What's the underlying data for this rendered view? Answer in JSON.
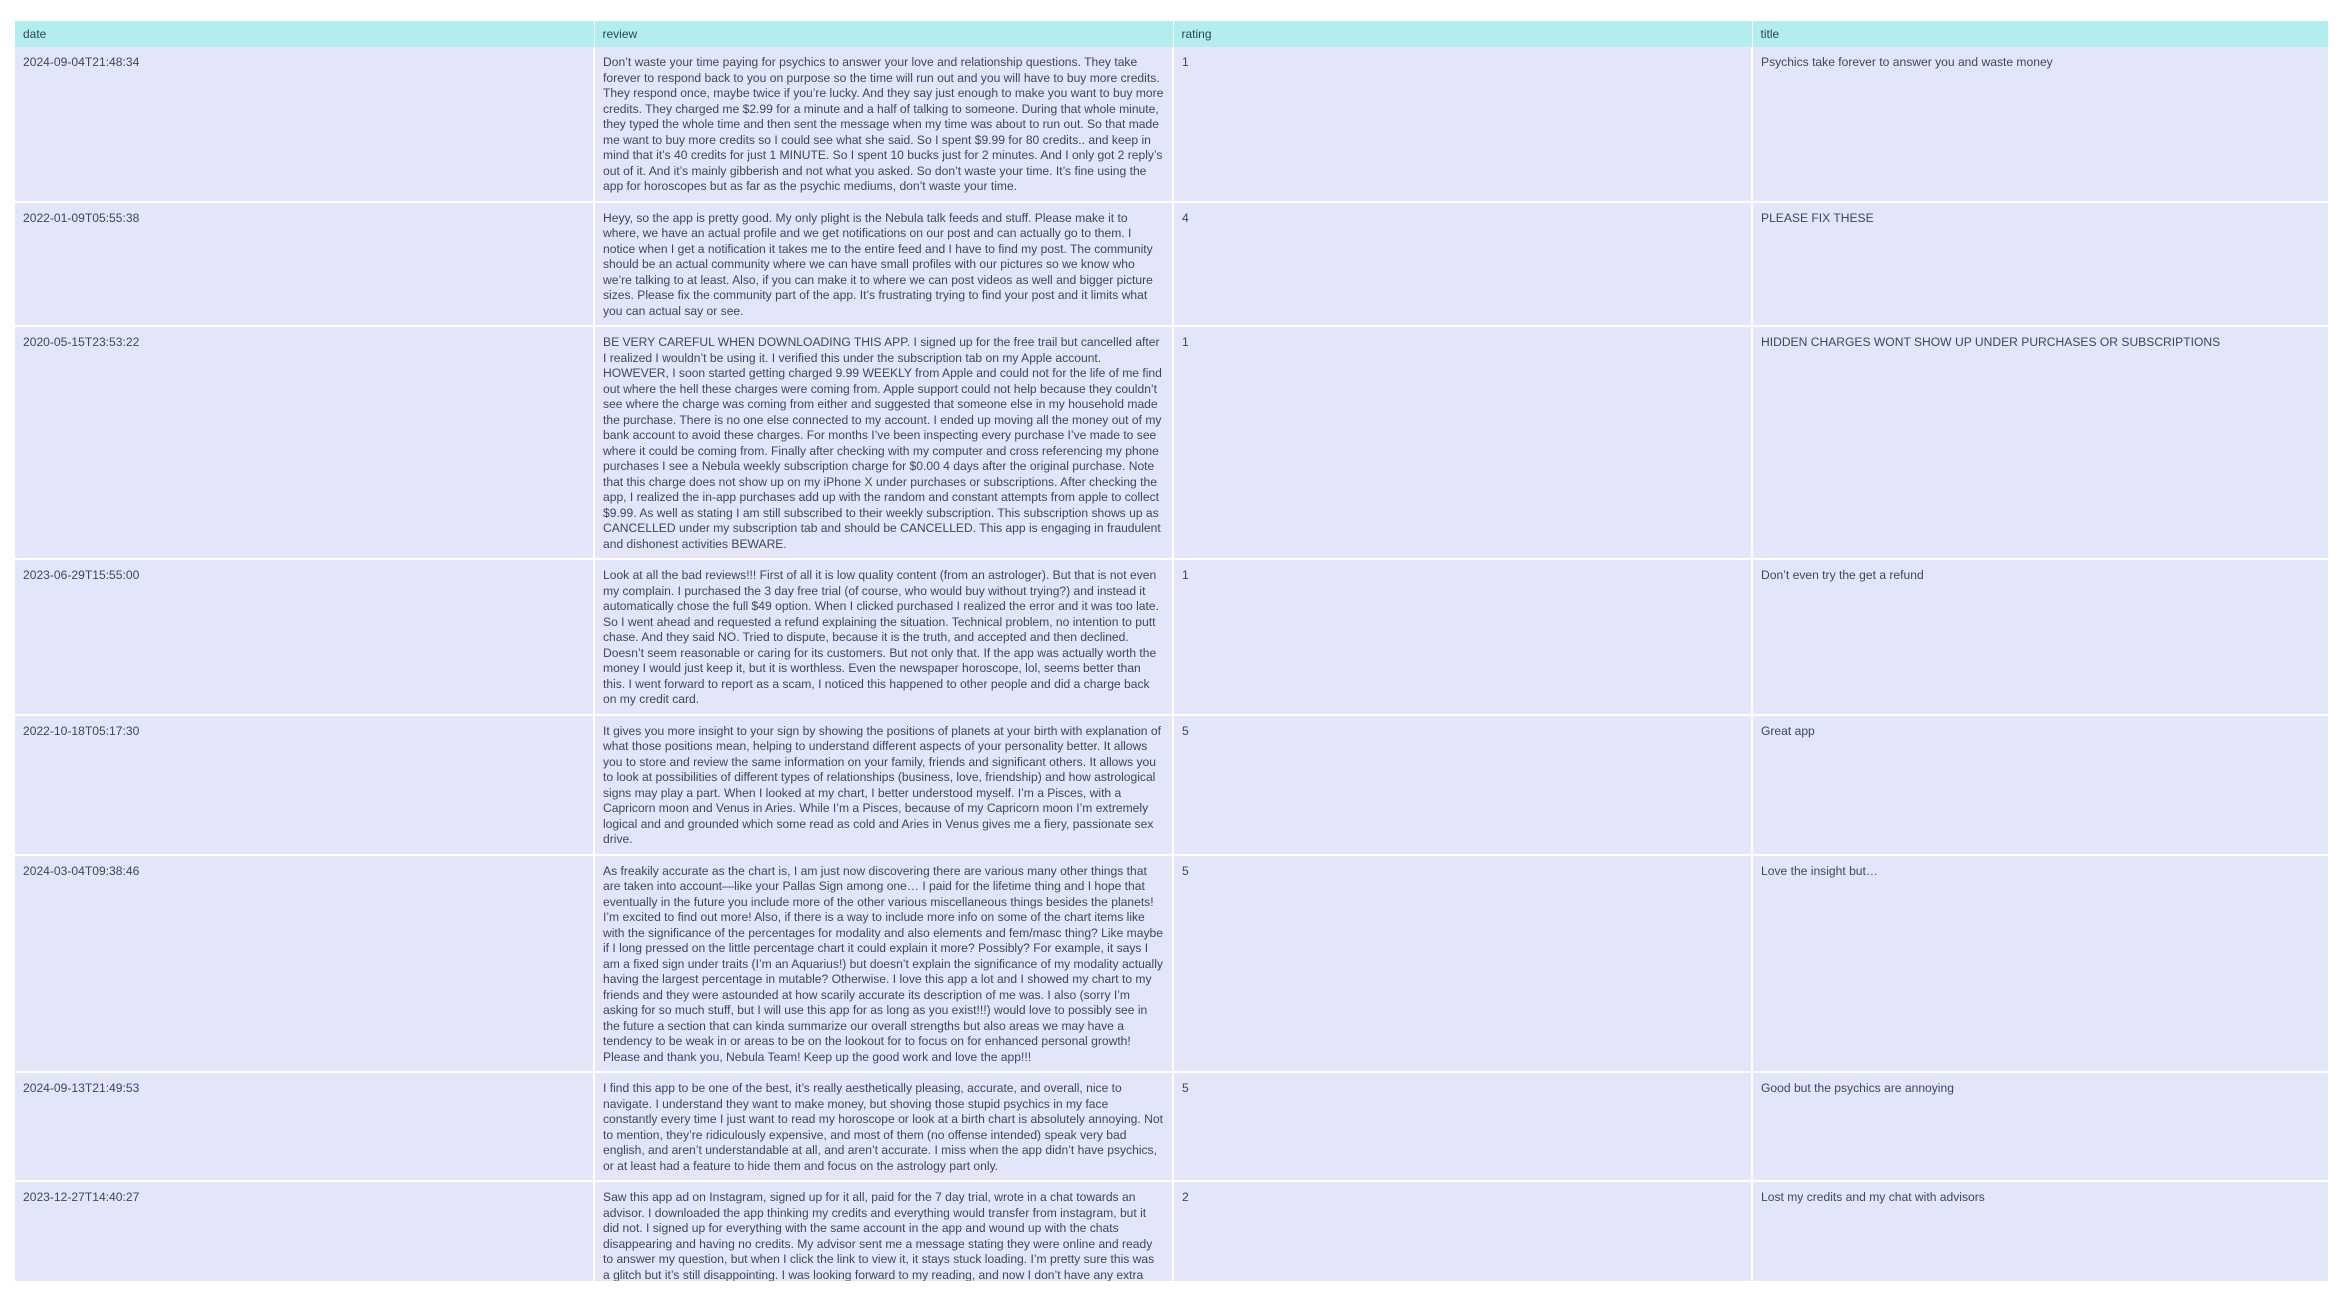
{
  "table": {
    "columns": [
      "date",
      "review",
      "rating",
      "title"
    ],
    "rows": [
      {
        "date": "2024-09-04T21:48:34",
        "review": "Don’t waste your time paying for psychics to answer your love and relationship questions. They take forever to respond back to you on purpose so the time will run out and you will have to buy more credits. They respond once, maybe twice if you’re lucky. And they say just enough to make you want to buy more credits. They charged me $2.99 for a minute and a half of talking to someone. During that whole minute, they typed the whole time and then sent the message when my time was about to run out. So that made me want to buy more credits so I could see what she said. So I spent $9.99 for 80 credits.. and keep in mind that it’s 40 credits for just 1 MINUTE. So I spent 10 bucks just for 2 minutes. And I only got 2 reply’s out of it. And it’s mainly gibberish and not what you asked. So don’t waste your time. It’s fine using the app for horoscopes but as far as the psychic mediums, don’t waste your time.",
        "rating": "1",
        "title": "Psychics take forever to answer you and waste money"
      },
      {
        "date": "2022-01-09T05:55:38",
        "review": "Heyy, so the app is pretty good. My only plight is the Nebula talk feeds and stuff. Please make it to where, we have an actual profile and we get notifications on our post and can actually go to them. I notice when I get a notification it takes me to the entire feed and I have to find my post. The community should be an actual community where we can have small profiles with our pictures so we know who we’re talking to at least. Also, if you can make it to where we can post videos as well and bigger picture sizes. Please fix the community part of the app. It’s frustrating trying to find your post and it limits what you can actual say or see.",
        "rating": "4",
        "title": "PLEASE FIX THESE"
      },
      {
        "date": "2020-05-15T23:53:22",
        "review": "BE VERY CAREFUL WHEN DOWNLOADING THIS APP. I signed up for the free trail but cancelled after I realized I wouldn’t be using it. I verified this under the subscription tab on my Apple account. HOWEVER, I soon started getting charged 9.99 WEEKLY from Apple and could not for the life of me find out where the hell these charges were coming from. Apple support could not help because they couldn’t see where the charge was coming from either and suggested that someone else in my household made the purchase. There is no one else connected to my account. I ended up moving all the money out of my bank account to avoid these charges. For months I’ve been inspecting every purchase I’ve made to see where it could be coming from. Finally after checking with my computer and cross referencing my phone purchases I see a Nebula weekly subscription charge for $0.00 4 days after the original purchase. Note that this charge does not show up on my iPhone X under purchases or subscriptions. After checking the app, I realized the in-app purchases add up with the random and constant attempts from apple to collect $9.99. As well as stating I am still subscribed to their weekly subscription. This subscription shows up as CANCELLED under my subscription tab and should be CANCELLED. This app is engaging in fraudulent and dishonest activities BEWARE.",
        "rating": "1",
        "title": "HIDDEN CHARGES WONT SHOW UP UNDER PURCHASES OR SUBSCRIPTIONS"
      },
      {
        "date": "2023-06-29T15:55:00",
        "review": "Look at all the bad reviews!!! First of all it is low quality content (from an astrologer). But that is not even my complain. I purchased the 3 day free trial (of course, who would buy without trying?) and instead it automatically chose the full $49 option. When I clicked purchased I realized the error and it was too late. So I went ahead and requested a refund explaining the situation. Technical problem, no intention to putt chase. And they said NO. Tried to dispute, because it is the truth, and accepted and then declined. Doesn’t seem reasonable or caring for its customers. But not only that. If the app was actually worth the money I would just keep it, but it is worthless. Even the newspaper horoscope, lol, seems better than this. I went forward to report as a scam, I noticed this happened to other people and did a charge back on my credit card.",
        "rating": "1",
        "title": "Don’t even try the get a refund"
      },
      {
        "date": "2022-10-18T05:17:30",
        "review": "It gives you more insight to your sign by showing the positions of planets at your birth with explanation of what those positions mean, helping to understand different aspects of your personality better.  It allows you to store and review the same information on your family, friends and significant others.   It allows you to look at possibilities of different types of relationships (business, love, friendship) and how astrological signs may play a part.   When I looked at my chart, I better understood myself. I’m a Pisces, with a Capricorn moon and Venus in Aries. While I’m a Pisces, because of my Capricorn moon I’m extremely logical and and grounded which some read as cold and Aries in Venus gives me a fiery, passionate sex drive.",
        "rating": "5",
        "title": "Great app"
      },
      {
        "date": "2024-03-04T09:38:46",
        "review": "As freakily accurate as the chart is, I am just now discovering there are various many other things that are taken into account—like your Pallas Sign among one…  I paid for the lifetime thing and I hope that eventually in the future you include more of the other various miscellaneous things besides the planets!  I’m excited to find out more!  Also, if there is a way to include more info on some of the chart items like with the significance of the percentages for modality and also elements and fem/masc thing?  Like maybe if I long pressed on the little percentage chart it could explain it more? Possibly? For example, it says I am a fixed sign under traits (I’m an Aquarius!) but doesn’t explain the significance of my modality actually having the largest percentage in mutable?  Otherwise. I love this app a lot and I showed my chart to my friends and they were astounded at how scarily accurate its description of me was.  I also (sorry I’m asking for so much stuff, but I will use this app for as long as you exist!!!) would love to possibly see in the future a section that can kinda summarize our overall strengths but also areas we may have a tendency to be weak in or areas to be on the lookout for to focus on for enhanced personal growth!  Please and thank you, Nebula Team!  Keep up the good work and love the app!!!",
        "rating": "5",
        "title": "Love the insight but…"
      },
      {
        "date": "2024-09-13T21:49:53",
        "review": "I find this app to be one of the best, it’s really aesthetically pleasing, accurate, and overall, nice to navigate. I understand they want to make money, but shoving those stupid psychics in my face constantly every time I just want to read my horoscope or look at a birth chart is absolutely annoying. Not to mention, they’re ridiculously expensive, and most of them (no offense intended) speak very bad english, and aren’t understandable at all, and aren’t accurate. I miss when the app didn’t have psychics, or at least had a feature to hide them and focus on the astrology part only.",
        "rating": "5",
        "title": "Good but the psychics are annoying"
      },
      {
        "date": "2023-12-27T14:40:27",
        "review": "Saw this app ad on Instagram, signed up for it all, paid for the 7 day trial, wrote in a chat towards an advisor. I downloaded the app thinking my credits and everything would transfer from instagram, but it did not. I signed up for everything with the same account in the app and wound up with the chats disappearing and having no credits. My advisor sent me a message stating they were online and ready to answer my question, but when I click the link to view it, it stays stuck loading. I’m pretty sure this was a glitch but it’s still disappointing. I was looking forward to my reading, and now I don’t have any extra",
        "rating": "2",
        "title": "Lost my credits and my chat with advisors"
      }
    ]
  }
}
